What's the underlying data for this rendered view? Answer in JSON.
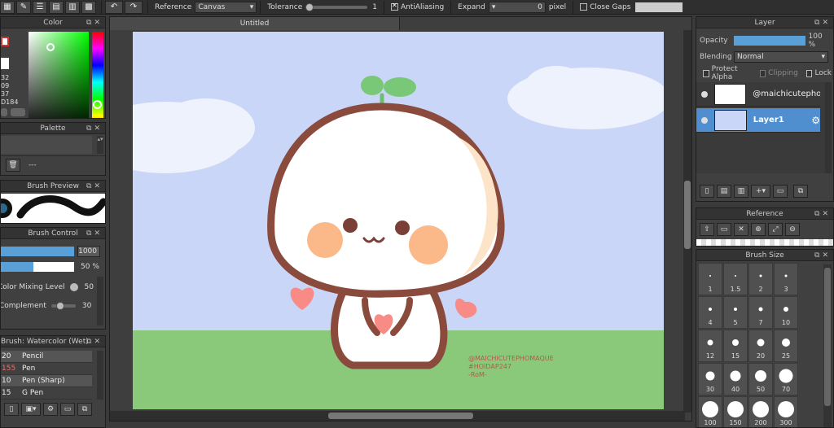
{
  "toolbar": {
    "reference_label": "Reference",
    "reference_value": "Canvas",
    "tolerance_label": "Tolerance",
    "tolerance_value": "1",
    "antialiasing_label": "AntiAliasing",
    "expand_label": "Expand",
    "expand_value": "0",
    "expand_unit": "pixel",
    "close_gaps_label": "Close Gaps"
  },
  "color_panel": {
    "title": "Color",
    "values": [
      "32",
      "09",
      "37",
      "D184"
    ]
  },
  "palette_panel": {
    "title": "Palette",
    "empty": "---"
  },
  "brush_preview_panel": {
    "title": "Brush Preview"
  },
  "brush_control_panel": {
    "title": "Brush Control",
    "size_value": "1000",
    "opacity_value": "50 %",
    "mixing_label": "Color Mixing Level",
    "mixing_value": "50",
    "complement_label": "Complement",
    "complement_value": "30"
  },
  "brush_list_panel": {
    "title": "Brush: Watercolor (Wet)",
    "items": [
      {
        "size": "20",
        "name": "Pencil"
      },
      {
        "size": "155",
        "name": "Pen"
      },
      {
        "size": "10",
        "name": "Pen (Sharp)"
      },
      {
        "size": "15",
        "name": "G Pen"
      }
    ]
  },
  "canvas": {
    "tab_title": "Untitled",
    "watermark": [
      "@MAICHICUTEPHOMAQUE",
      "#HOIDAP247",
      "-RoM-"
    ]
  },
  "layer_panel": {
    "title": "Layer",
    "opacity_label": "Opacity",
    "opacity_value": "100 %",
    "blending_label": "Blending",
    "blending_value": "Normal",
    "protect_alpha_label": "Protect Alpha",
    "clipping_label": "Clipping",
    "lock_label": "Lock",
    "layers": [
      {
        "name": "@maichicutephom"
      },
      {
        "name": "Layer1"
      }
    ]
  },
  "reference_panel": {
    "title": "Reference"
  },
  "brush_size_panel": {
    "title": "Brush Size",
    "sizes": [
      "1",
      "1.5",
      "2",
      "3",
      "4",
      "5",
      "7",
      "10",
      "12",
      "15",
      "20",
      "25",
      "30",
      "40",
      "50",
      "70",
      "100",
      "150",
      "200",
      "300"
    ]
  },
  "colors": {
    "accent": "#4f8fcf",
    "canvas_bg": "#c9d6f7",
    "grass": "#8bc97a",
    "outline": "#8a4a3c"
  }
}
